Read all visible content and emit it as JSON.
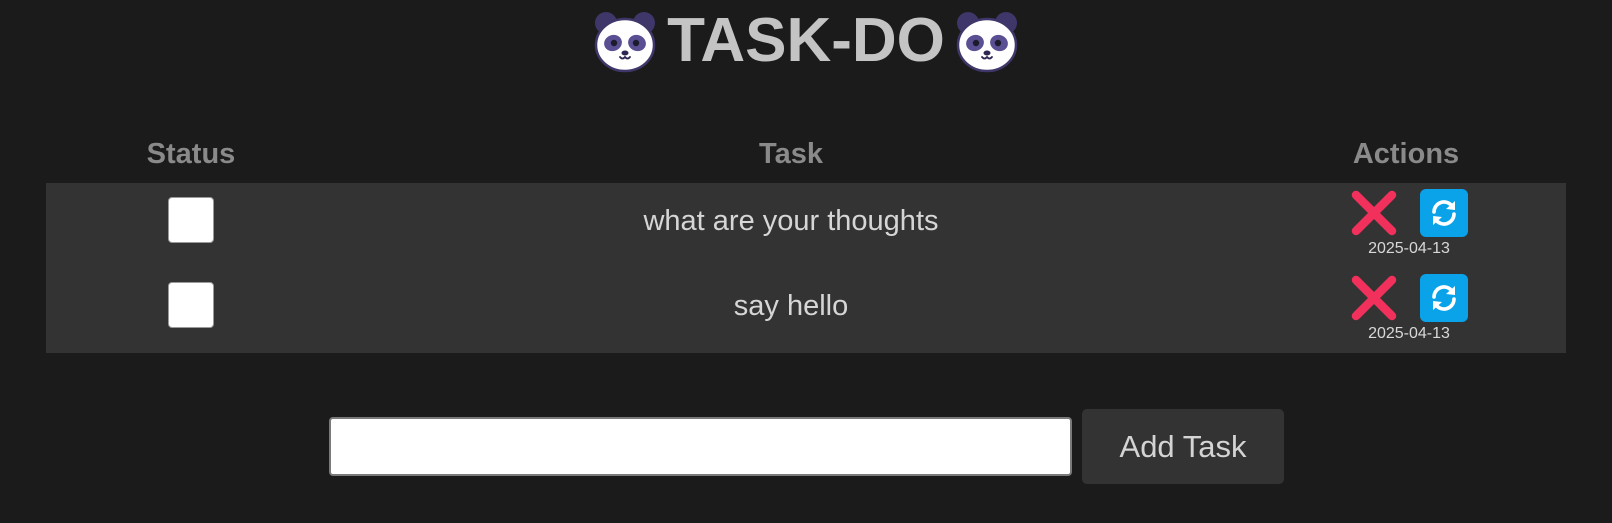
{
  "header": {
    "title": "TASK-DO",
    "left_icon": "panda-face-icon",
    "right_icon": "panda-face-icon"
  },
  "table": {
    "columns": [
      "Status",
      "Task",
      "Actions"
    ],
    "rows": [
      {
        "done": false,
        "task": "what are your thoughts",
        "date": "2025-04-13"
      },
      {
        "done": false,
        "task": "say hello",
        "date": "2025-04-13"
      }
    ]
  },
  "form": {
    "input_value": "",
    "input_placeholder": "",
    "add_button_label": "Add Task"
  },
  "colors": {
    "background": "#1b1b1b",
    "row_background": "#333333",
    "delete_icon": "#f2305c",
    "update_button": "#0aa3ea"
  },
  "icons": {
    "delete": "close-x-icon",
    "update": "refresh-icon"
  }
}
